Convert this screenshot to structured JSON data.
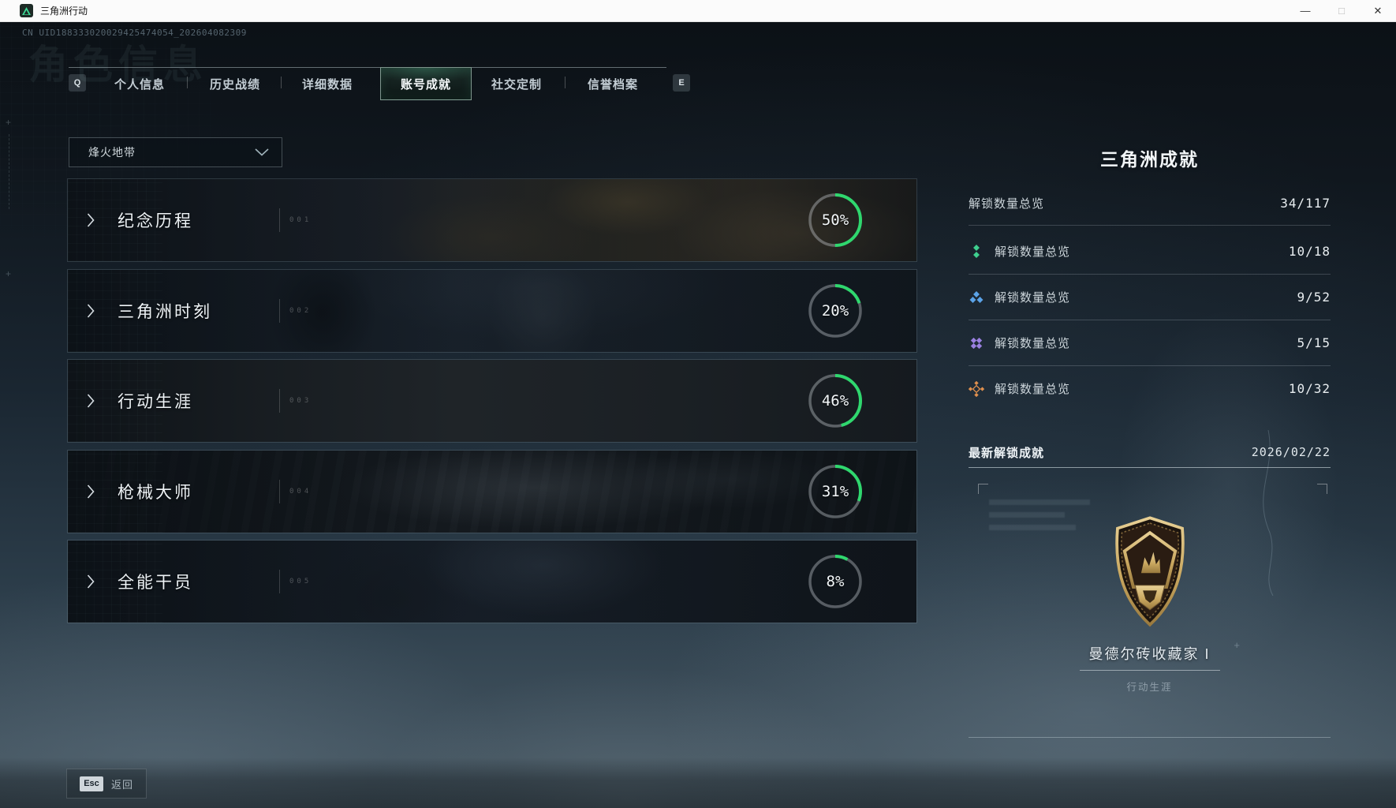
{
  "window": {
    "title": "三角洲行动"
  },
  "icons": {
    "minimize": "—",
    "maximize": "□",
    "close": "✕"
  },
  "header": {
    "uid": "CN UID188333020029425474054_202604082309",
    "watermark": "角色信息",
    "key_left": "Q",
    "key_right": "E",
    "tabs": [
      {
        "label": "个人信息",
        "active": false
      },
      {
        "label": "历史战绩",
        "active": false
      },
      {
        "label": "详细数据",
        "active": false
      },
      {
        "label": "账号成就",
        "active": true
      },
      {
        "label": "社交定制",
        "active": false
      },
      {
        "label": "信誉档案",
        "active": false
      }
    ]
  },
  "filter": {
    "selected": "烽火地带"
  },
  "accent": {
    "progress_green": "#2fd76e",
    "active_tab_border": "#b9d6ca"
  },
  "categories": [
    {
      "label": "纪念历程",
      "index": "001",
      "percent": 50,
      "percent_label": "50%"
    },
    {
      "label": "三角洲时刻",
      "index": "002",
      "percent": 20,
      "percent_label": "20%"
    },
    {
      "label": "行动生涯",
      "index": "003",
      "percent": 46,
      "percent_label": "46%"
    },
    {
      "label": "枪械大师",
      "index": "004",
      "percent": 31,
      "percent_label": "31%"
    },
    {
      "label": "全能干员",
      "index": "005",
      "percent": 8,
      "percent_label": "8%"
    }
  ],
  "sidebar": {
    "title": "三角洲成就",
    "total": {
      "label": "解锁数量总览",
      "value": "34/117"
    },
    "groups": [
      {
        "icon": "green-diamonds-icon",
        "color": "#3ecf8e",
        "label": "解锁数量总览",
        "value": "10/18"
      },
      {
        "icon": "blue-diamonds-icon",
        "color": "#5ba3e8",
        "label": "解锁数量总览",
        "value": "9/52"
      },
      {
        "icon": "purple-diamonds-icon",
        "color": "#9a80e0",
        "label": "解锁数量总览",
        "value": "5/15"
      },
      {
        "icon": "orange-diamonds-icon",
        "color": "#e0904e",
        "label": "解锁数量总览",
        "value": "10/32"
      }
    ],
    "latest": {
      "label": "最新解锁成就",
      "date": "2026/02/22",
      "badge_name": "曼德尔砖收藏家 I",
      "badge_category": "行动生涯"
    }
  },
  "footer": {
    "esc_key": "Esc",
    "back_label": "返回"
  }
}
